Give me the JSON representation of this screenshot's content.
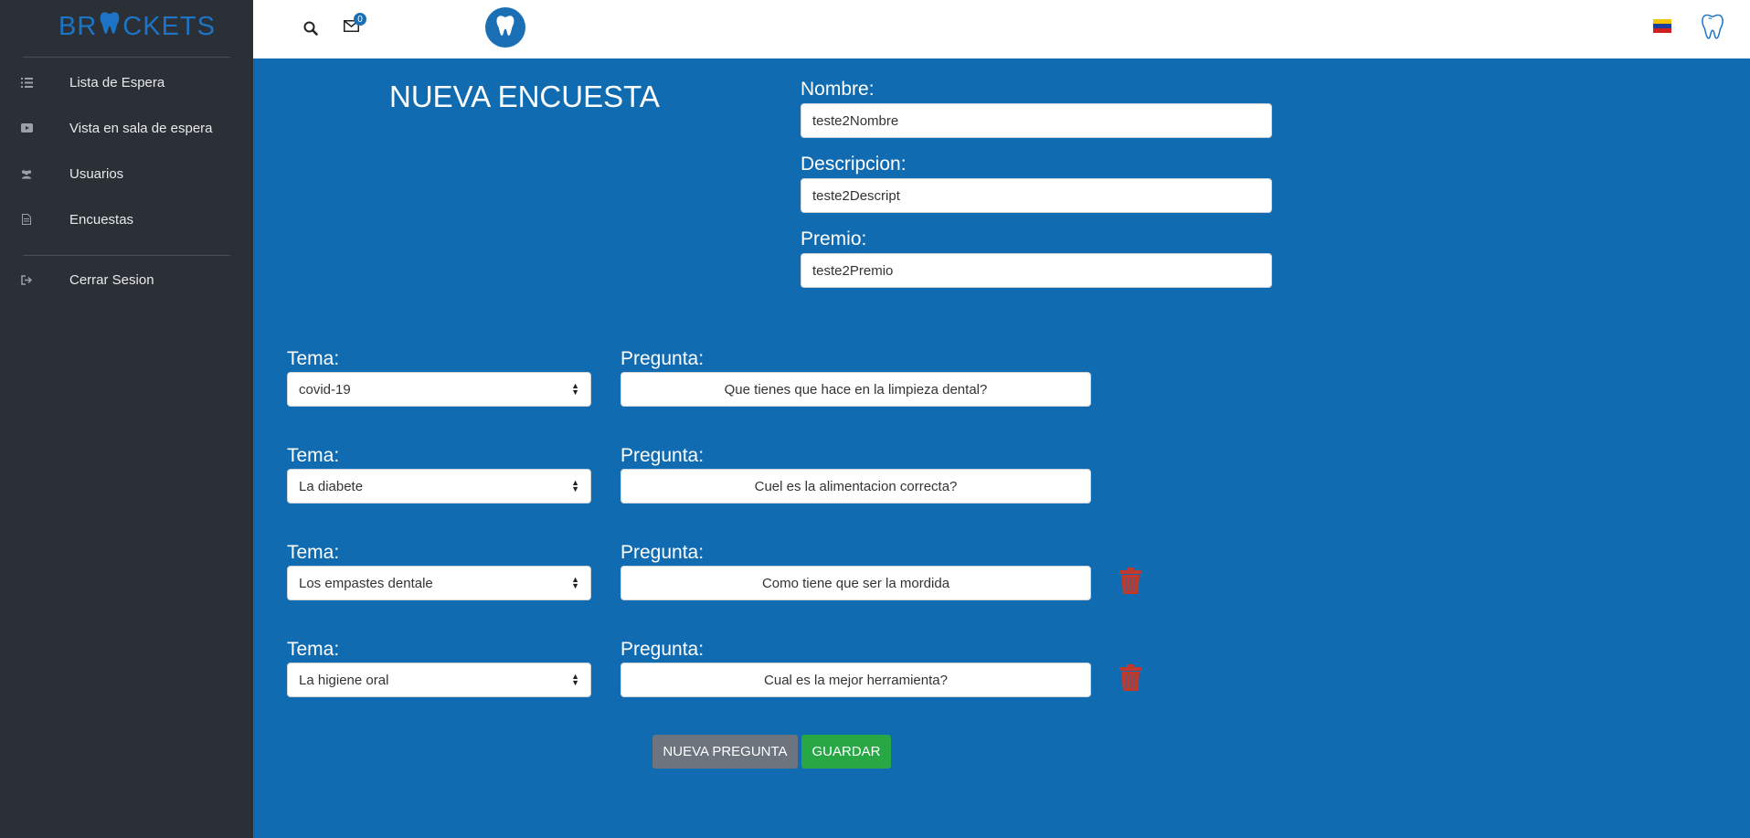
{
  "brand": {
    "part1": "BR",
    "part2": "CKETS"
  },
  "sidebar": {
    "items": [
      {
        "label": "Lista de Espera",
        "icon": "list-icon"
      },
      {
        "label": "Vista en sala de espera",
        "icon": "video-icon"
      },
      {
        "label": "Usuarios",
        "icon": "users-icon"
      },
      {
        "label": "Encuestas",
        "icon": "document-icon"
      },
      {
        "label": "Cerrar Sesion",
        "icon": "sign-out-icon"
      }
    ]
  },
  "topbar": {
    "message_count": "0"
  },
  "page": {
    "title": "NUEVA ENCUESTA"
  },
  "form": {
    "nombre_label": "Nombre:",
    "nombre_value": "teste2Nombre",
    "descripcion_label": "Descripcion:",
    "descripcion_value": "teste2Descript",
    "premio_label": "Premio:",
    "premio_value": "teste2Premio"
  },
  "questions": [
    {
      "tema_label": "Tema:",
      "tema": "covid-19",
      "pregunta_label": "Pregunta:",
      "pregunta": "Que tienes que hace en la limpieza dental?"
    },
    {
      "tema_label": "Tema:",
      "tema": "La diabete",
      "pregunta_label": "Pregunta:",
      "pregunta": "Cuel es la alimentacion correcta?"
    },
    {
      "tema_label": "Tema:",
      "tema": "Los empastes dentale",
      "pregunta_label": "Pregunta:",
      "pregunta": "Como tiene que ser la mordida"
    },
    {
      "tema_label": "Tema:",
      "tema": "La higiene oral",
      "pregunta_label": "Pregunta:",
      "pregunta": "Cual es la mejor herramienta?"
    }
  ],
  "buttons": {
    "nueva_pregunta": "NUEVA PREGUNTA",
    "guardar": "GUARDAR"
  },
  "colors": {
    "main_bg": "#106bb0",
    "sidebar_bg": "#2b2f36",
    "brand": "#1e74c4",
    "guardar": "#28a745",
    "nueva": "#6c757d",
    "trash": "#c0392b"
  }
}
